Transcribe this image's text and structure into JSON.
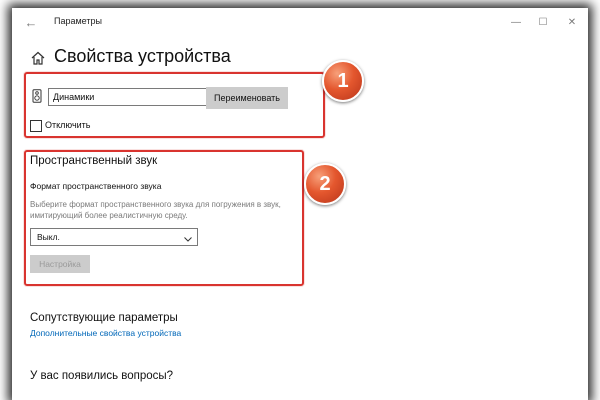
{
  "window": {
    "title": "Параметры",
    "back_glyph": "←",
    "minimize_glyph": "—",
    "maximize_glyph": "☐",
    "close_glyph": "✕"
  },
  "header": {
    "title": "Свойства устройства",
    "home_icon": "home-icon"
  },
  "device": {
    "icon": "speaker-icon",
    "name_value": "Динамики",
    "rename_label": "Переименовать",
    "disable_label": "Отключить",
    "disable_checked": false
  },
  "spatial": {
    "title": "Пространственный звук",
    "format_label": "Формат пространственного звука",
    "format_description": "Выберите формат пространственного звука для погружения в звук, имитирующий более реалистичную среду.",
    "format_value": "Выкл.",
    "setup_label": "Настройка"
  },
  "related": {
    "title": "Сопутствующие параметры",
    "link_label": "Дополнительные свойства устройства"
  },
  "questions": {
    "title": "У вас появились вопросы?"
  },
  "annotations": {
    "badge_1": "1",
    "badge_2": "2",
    "color": "#d9342f",
    "badge_color": "#e4572e"
  },
  "colors": {
    "link": "#0067b8",
    "button_bg": "#cccccc",
    "muted_text": "#7a7a7a"
  }
}
